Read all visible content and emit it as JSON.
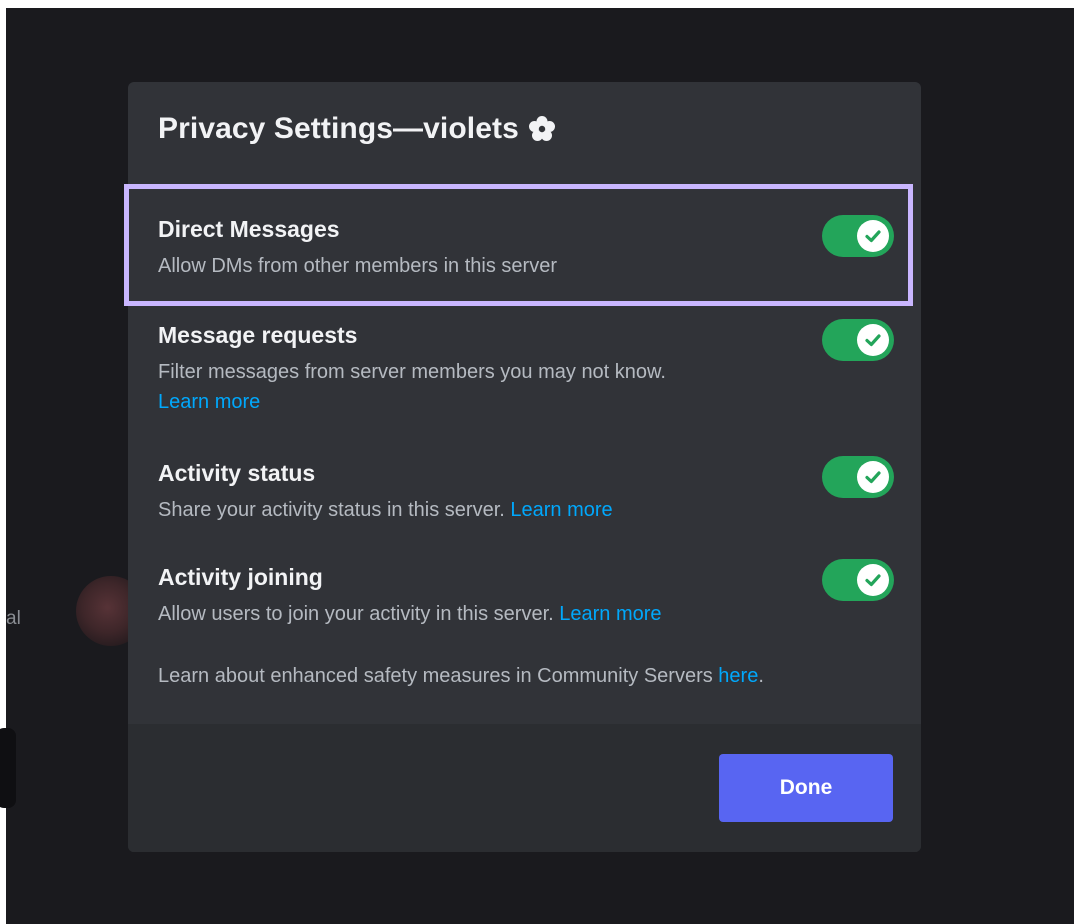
{
  "background": {
    "partial_label": "al"
  },
  "modal": {
    "title": "Privacy Settings—violets",
    "title_icon": "flower-icon",
    "settings": [
      {
        "label": "Direct Messages",
        "description": "Allow DMs from other members in this server",
        "enabled": true
      },
      {
        "label": "Message requests",
        "description": "Filter messages from server members you may not know.",
        "link": "Learn more",
        "enabled": true
      },
      {
        "label": "Activity status",
        "description": "Share your activity status in this server.",
        "link": "Learn more",
        "enabled": true
      },
      {
        "label": "Activity joining",
        "description": "Allow users to join your activity in this server.",
        "link": "Learn more",
        "enabled": true
      }
    ],
    "footer_note": {
      "text": "Learn about enhanced safety measures in Community Servers ",
      "link": "here",
      "suffix": "."
    },
    "done_label": "Done"
  },
  "colors": {
    "toggle_on": "#23a55a",
    "highlight": "#c9b6ff",
    "button": "#5865f2",
    "link": "#00a8fc"
  }
}
